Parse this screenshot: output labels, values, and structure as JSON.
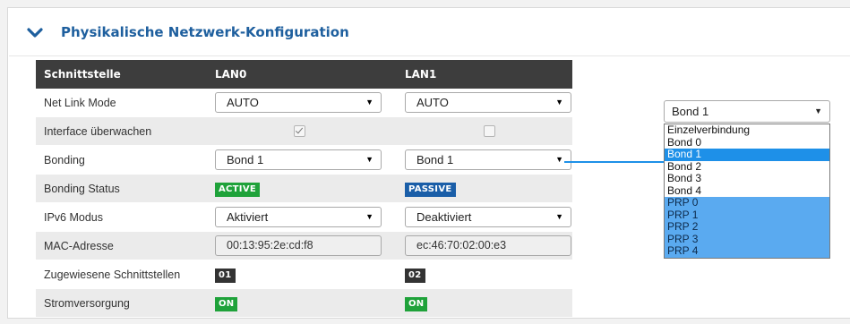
{
  "section": {
    "title": "Physikalische Netzwerk-Konfiguration"
  },
  "table": {
    "headers": [
      "Schnittstelle",
      "LAN0",
      "LAN1"
    ],
    "rows": {
      "net_link_mode": {
        "label": "Net Link Mode",
        "lan0": "AUTO",
        "lan1": "AUTO"
      },
      "interface_monitor": {
        "label": "Interface überwachen",
        "lan0_checked": true,
        "lan1_checked": false
      },
      "bonding": {
        "label": "Bonding",
        "lan0": "Bond 1",
        "lan1": "Bond 1"
      },
      "bonding_status": {
        "label": "Bonding Status",
        "lan0": "ACTIVE",
        "lan1": "PASSIVE"
      },
      "ipv6": {
        "label": "IPv6 Modus",
        "lan0": "Aktiviert",
        "lan1": "Deaktiviert"
      },
      "mac": {
        "label": "MAC-Adresse",
        "lan0": "00:13:95:2e:cd:f8",
        "lan1": "ec:46:70:02:00:e3"
      },
      "assigned": {
        "label": "Zugewiesene Schnittstellen",
        "lan0": "01",
        "lan1": "02"
      },
      "power": {
        "label": "Stromversorgung",
        "lan0": "ON",
        "lan1": "ON"
      }
    }
  },
  "dropdown": {
    "selected": "Bond 1",
    "options": [
      "Einzelverbindung",
      "Bond 0",
      "Bond 1",
      "Bond 2",
      "Bond 3",
      "Bond 4",
      "PRP 0",
      "PRP 1",
      "PRP 2",
      "PRP 3",
      "PRP 4"
    ]
  },
  "colors": {
    "title_blue": "#1e5f9e",
    "header_dark": "#3d3d3d",
    "active_green": "#1fa23a",
    "passive_blue": "#1a5ea8",
    "highlight_blue": "#1e90e8",
    "prp_blue": "#5aaaf0"
  },
  "icons": {
    "collapse": "chevron-down-icon",
    "select_arrow": "caret-down-icon",
    "checkbox": "checkbox-icon"
  }
}
